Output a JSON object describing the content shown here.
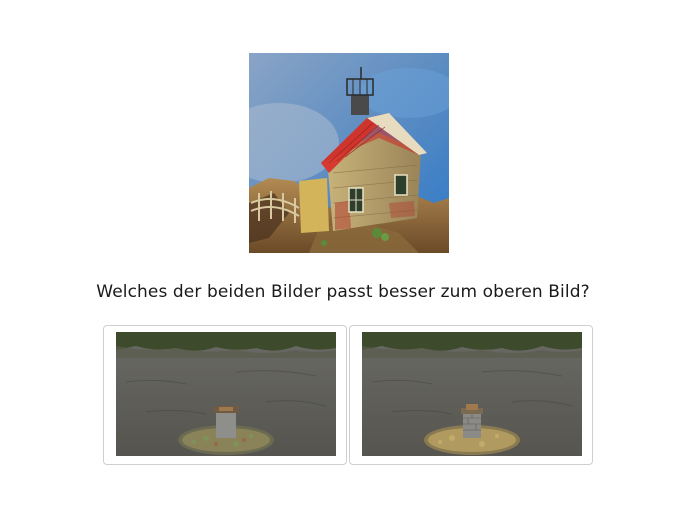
{
  "prompt": {
    "question": "Welches der beiden Bilder passt besser zum oberen Bild?"
  },
  "reference_image": {
    "icon": "house-on-rock-image"
  },
  "options": [
    {
      "icon": "stone-pedestal-scene-image",
      "variant": "left"
    },
    {
      "icon": "stone-pedestal-scene-image",
      "variant": "right"
    }
  ],
  "colors": {
    "roof_red": "#c9302c",
    "sky_blue": "#3d7fc4",
    "ground_gray": "#5f5e5a",
    "option_border": "#cfcfcf"
  }
}
